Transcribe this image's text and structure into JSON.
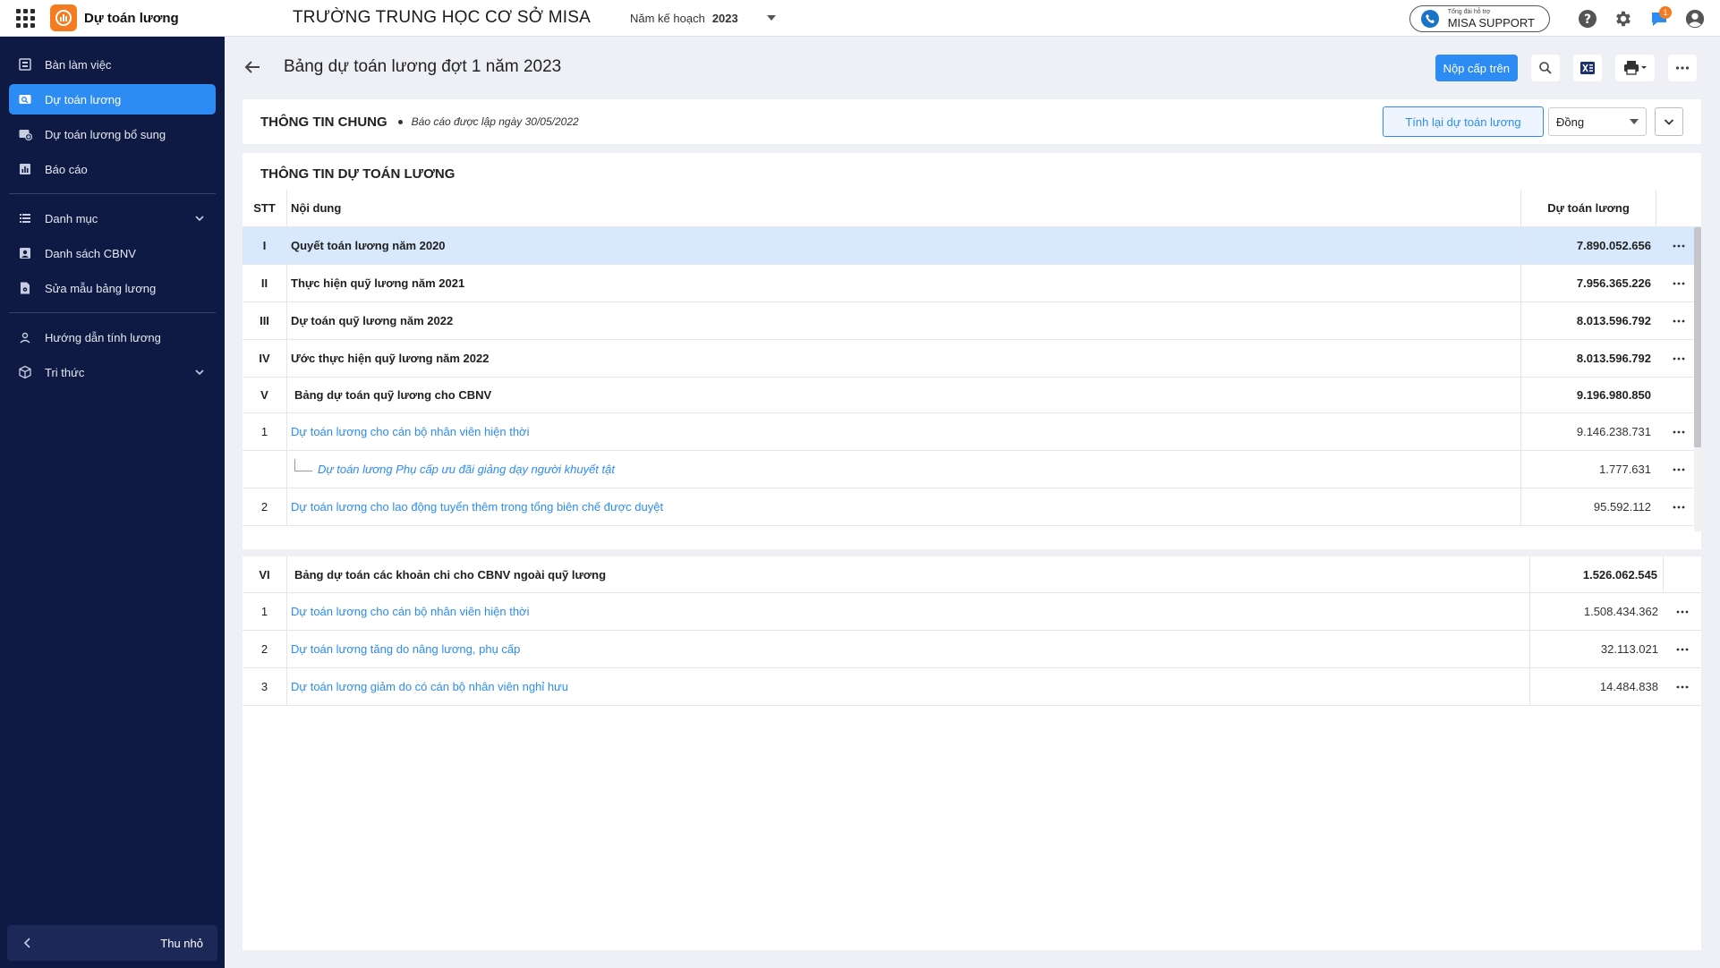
{
  "app": {
    "name": "Dự toán lương",
    "org_name": "TRƯỜNG TRUNG HỌC CƠ SỞ MISA",
    "plan_year_label": "Năm kế hoạch",
    "plan_year_value": "2023",
    "support_small": "Tổng đài hỗ trợ",
    "support_big": "MISA SUPPORT",
    "notification_count": "1",
    "brand_color": "#f47b20",
    "accent_color": "#2c8cf4",
    "sidebar_color": "#0e1a44"
  },
  "sidebar": {
    "items": [
      {
        "label": "Bàn làm việc",
        "icon": "desk-icon"
      },
      {
        "label": "Dự toán lương",
        "icon": "estimate-icon",
        "active": true
      },
      {
        "label": "Dự toán lương bổ sung",
        "icon": "supplement-icon"
      },
      {
        "label": "Báo cáo",
        "icon": "report-icon"
      },
      {
        "label": "Danh mục",
        "icon": "list-icon",
        "expandable": true
      },
      {
        "label": "Danh sách CBNV",
        "icon": "staff-icon"
      },
      {
        "label": "Sửa mẫu bảng lương",
        "icon": "template-icon"
      },
      {
        "label": "Hướng dẫn tính lương",
        "icon": "guide-icon"
      },
      {
        "label": "Tri thức",
        "icon": "knowledge-icon",
        "expandable": true
      }
    ],
    "collapse_label": "Thu nhỏ"
  },
  "page": {
    "title": "Bảng dự toán lương đợt 1 năm 2023",
    "submit_label": "Nộp cấp trên"
  },
  "general": {
    "title": "THÔNG TIN CHUNG",
    "subtitle": "Báo cáo được lập ngày 30/05/2022",
    "recalc_label": "Tính lại dự toán lương",
    "currency_value": "Đồng"
  },
  "estimate": {
    "title": "THÔNG TIN DỰ TOÁN LƯƠNG",
    "headers": {
      "stt": "STT",
      "content": "Nội dung",
      "value": "Dự toán lương"
    },
    "rows": [
      {
        "stt": "I",
        "content": "Quyết toán lương năm 2020",
        "value": "7.890.052.656"
      },
      {
        "stt": "II",
        "content": "Thực hiện quỹ lương năm 2021",
        "value": "7.956.365.226"
      },
      {
        "stt": "III",
        "content": "Dự toán quỹ lương năm 2022",
        "value": "8.013.596.792"
      },
      {
        "stt": "IV",
        "content": "Ước thực hiện quỹ lương năm 2022",
        "value": "8.013.596.792"
      },
      {
        "stt": "V",
        "content": "Bảng dự toán quỹ lương cho CBNV",
        "value": "9.196.980.850"
      },
      {
        "stt": "1",
        "content": "Dự toán lương cho cán bộ nhân viên hiện thời",
        "value": "9.146.238.731"
      },
      {
        "stt": "",
        "content": "Dự toán lương Phụ cấp ưu đãi giảng dạy người khuyết tật",
        "value": "1.777.631"
      },
      {
        "stt": "2",
        "content": "Dự toán lương cho lao động tuyển thêm trong tổng biên chế được duyệt",
        "value": "95.592.112"
      }
    ],
    "rows2": [
      {
        "stt": "VI",
        "content": "Bảng dự toán các khoản chi cho CBNV ngoài quỹ lương",
        "value": "1.526.062.545"
      },
      {
        "stt": "1",
        "content": "Dự toán lương cho cán bộ nhân viên hiện thời",
        "value": "1.508.434.362"
      },
      {
        "stt": "2",
        "content": "Dự toán lương tăng do nâng lương, phụ cấp",
        "value": "32.113.021"
      },
      {
        "stt": "3",
        "content": "Dự toán lương giảm do có cán bộ nhân viên nghỉ hưu",
        "value": "14.484.838"
      }
    ]
  }
}
